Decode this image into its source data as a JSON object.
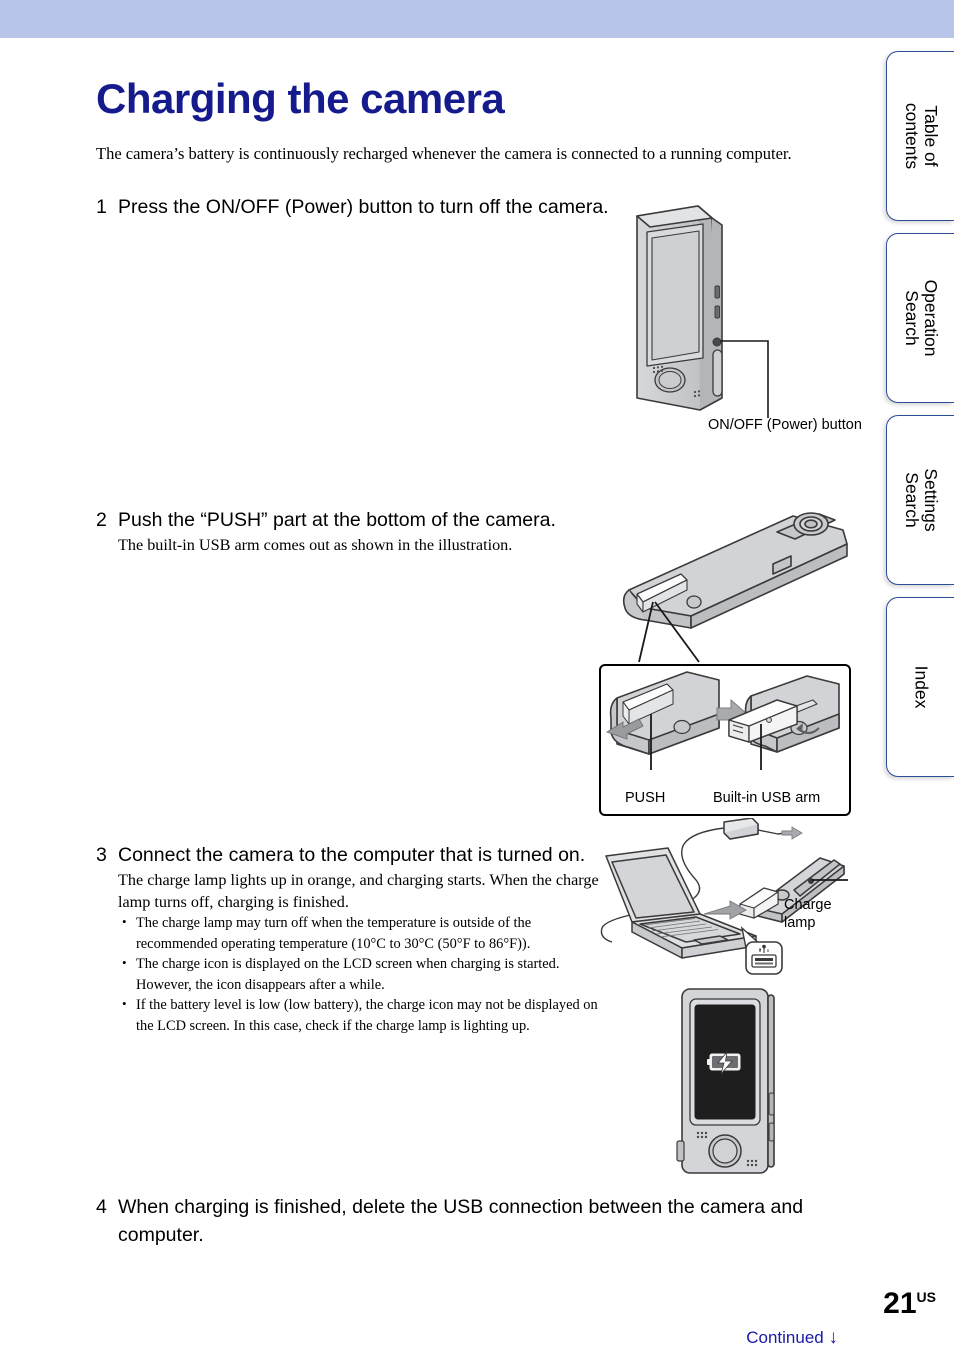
{
  "document": {
    "title": "Charging the camera",
    "title_color": "#151a8c",
    "banner_color": "#b9c5e8",
    "intro": "The camera’s battery is continuously recharged whenever the camera is connected to a running computer."
  },
  "side_tabs": [
    {
      "label": "Table of\ncontents",
      "name": "table-of-contents"
    },
    {
      "label": "Operation\nSearch",
      "name": "operation-search"
    },
    {
      "label": "Settings\nSearch",
      "name": "settings-search"
    },
    {
      "label": "Index",
      "name": "index"
    }
  ],
  "steps": [
    {
      "number": "1",
      "title": "Press the ON/OFF (Power) button to turn off the camera.",
      "body": "",
      "notes": []
    },
    {
      "number": "2",
      "title": "Push the “PUSH” part at the bottom of the camera.",
      "body": "The built-in USB arm comes out as shown in the illustration.",
      "notes": []
    },
    {
      "number": "3",
      "title": "Connect the camera to the computer that is turned on.",
      "body": "The charge lamp lights up in orange, and charging starts. When the charge lamp turns off, charging is finished.",
      "notes": [
        "The charge lamp may turn off when the temperature is outside of the recommended operating temperature (10°C to 30°C (50°F to 86°F)).",
        "The charge icon is displayed on the LCD screen when charging is started. However, the icon disappears after a while.",
        "If the battery level is low (low battery), the charge icon may not be displayed on the LCD screen. In this case, check if the charge lamp is lighting up."
      ]
    },
    {
      "number": "4",
      "title": "When charging is finished, delete the USB connection between the camera and computer.",
      "body": "",
      "notes": []
    }
  ],
  "figures": {
    "fig1": {
      "name": "camera-power-button-illustration",
      "callout": "ON/OFF (Power) button"
    },
    "fig2": {
      "name": "camera-usb-arm-illustration",
      "detail_labels": {
        "push": "PUSH",
        "usb_arm": "Built-in USB arm"
      }
    },
    "fig3": {
      "name": "laptop-connection-illustration",
      "callout": "Charge lamp"
    },
    "fig4": {
      "name": "camera-lcd-charging-icon-illustration"
    }
  },
  "footer": {
    "page_number": "21",
    "page_suffix": "US",
    "continued": "Continued",
    "continued_arrow": "↓",
    "continued_color": "#1a1aa8"
  }
}
